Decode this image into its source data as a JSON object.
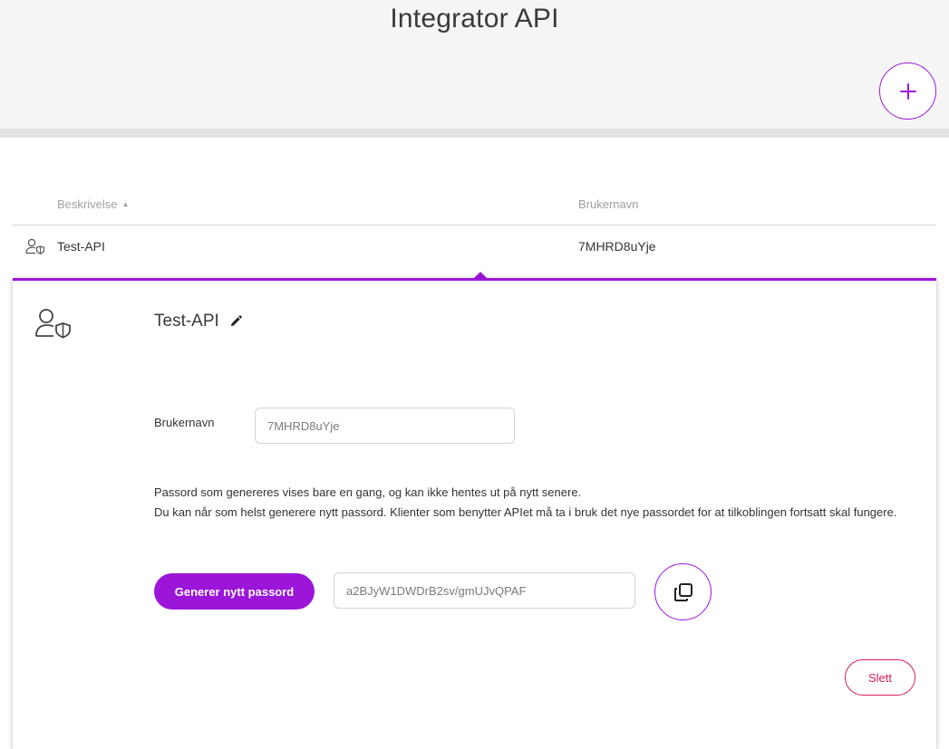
{
  "header": {
    "title": "Integrator API",
    "add_icon": "plus-icon"
  },
  "colors": {
    "accent": "#9b16d8",
    "danger": "#d81e5b",
    "header_bg": "#f5f5f5"
  },
  "table": {
    "columns": [
      {
        "label": "Beskrivelse",
        "sort": "ascending"
      },
      {
        "label": "Brukernavn"
      }
    ],
    "rows": [
      {
        "icon": "user-shield-icon",
        "description": "Test-API",
        "username": "7MHRD8uYje"
      }
    ]
  },
  "detail": {
    "icon": "user-shield-icon",
    "title": "Test-API",
    "edit_icon": "pencil-icon",
    "username_label": "Brukernavn",
    "username_value": "7MHRD8uYje",
    "info_line1": "Passord som genereres vises bare en gang, og kan ikke hentes ut på nytt senere.",
    "info_line2": "Du kan når som helst generere nytt passord. Klienter som benytter APIet må ta i bruk det nye passordet for at tilkoblingen fortsatt skal fungere.",
    "generate_label": "Generer nytt passord",
    "password_value": "a2BJyW1DWDrB2sv/gmUJvQPAF",
    "copy_icon": "copy-icon",
    "delete_label": "Slett"
  }
}
